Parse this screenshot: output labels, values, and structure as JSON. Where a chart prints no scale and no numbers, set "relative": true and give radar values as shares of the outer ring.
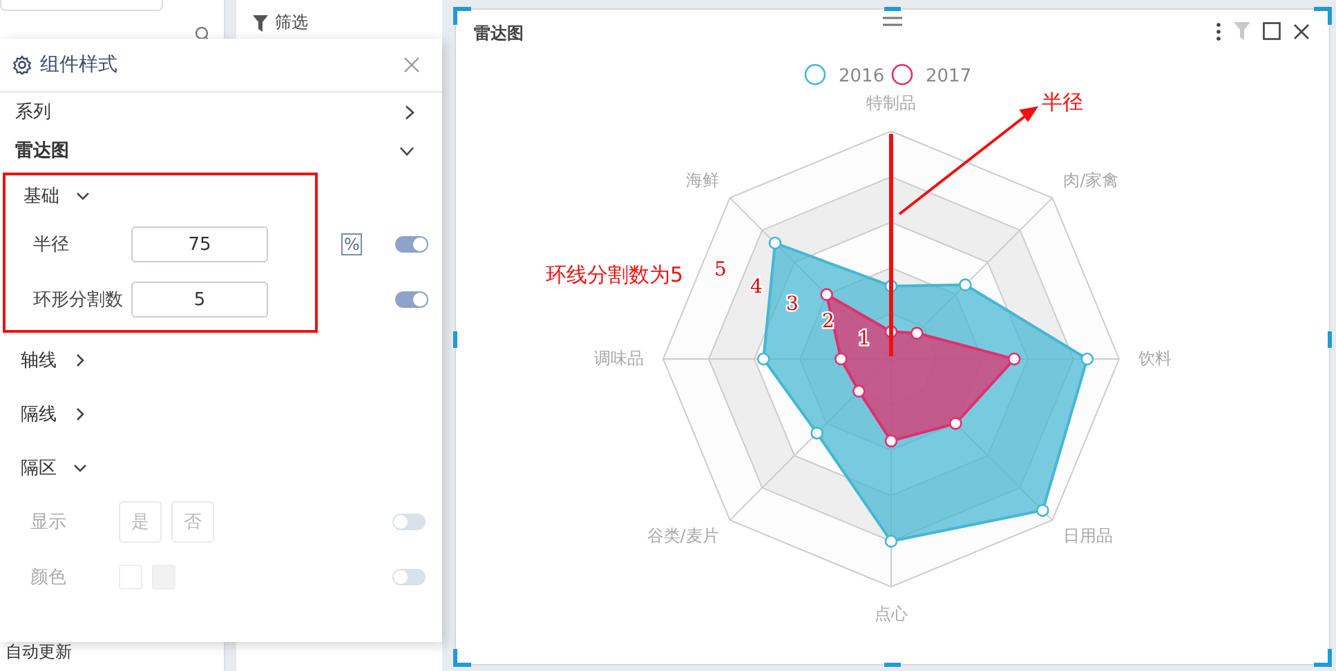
{
  "filter_pane": {
    "title": "筛选"
  },
  "sidebar": {
    "bottom_label": "自动更新"
  },
  "style_panel": {
    "title": "组件样式",
    "rows": [
      {
        "kind": "link",
        "label": "系列",
        "highlighted": false
      },
      {
        "kind": "header",
        "label": "雷达图",
        "expanded": true,
        "highlighted": false
      },
      {
        "kind": "sub",
        "label": "基础",
        "expanded": true,
        "highlighted": true
      },
      {
        "kind": "input",
        "label": "半径",
        "value": "75",
        "unit": "%",
        "on": true,
        "highlighted": true
      },
      {
        "kind": "input",
        "label": "环形分割数",
        "value": "5",
        "on": true,
        "highlighted": true
      },
      {
        "kind": "sub",
        "label": "轴线",
        "expanded": false,
        "highlighted": false
      },
      {
        "kind": "sub",
        "label": "隔线",
        "expanded": false,
        "highlighted": false
      },
      {
        "kind": "sub",
        "label": "隔区",
        "expanded": true,
        "highlighted": false
      },
      {
        "kind": "choice",
        "label": "显示",
        "options": [
          {
            "label": "是",
            "selected": false
          },
          {
            "label": "否",
            "selected": false
          }
        ],
        "on": false,
        "disabled": true,
        "highlighted": false
      },
      {
        "kind": "swatches",
        "label": "颜色",
        "swatches": [
          {
            "color": "#ffffff"
          },
          {
            "color": "#f2f2f2"
          }
        ],
        "on": false,
        "disabled": true,
        "highlighted": false
      }
    ]
  },
  "chart_card": {
    "title": "雷达图",
    "ring_labels": [
      "1",
      "2",
      "3",
      "4",
      "5"
    ],
    "notes": {
      "radius": "半径",
      "rings": "环线分割数为5"
    },
    "chart_data": {
      "type": "radar",
      "categories": [
        "特制品",
        "肉/家禽",
        "饮料",
        "日用品",
        "点心",
        "谷类/麦片",
        "调味品",
        "海鲜"
      ],
      "relative": true,
      "legend": "top",
      "series": [
        {
          "name": "2016",
          "color": "#45b7d3",
          "values": [
            0.32,
            0.46,
            0.86,
            0.94,
            0.8,
            0.46,
            0.56,
            0.72
          ]
        },
        {
          "name": "2017",
          "color": "#e0306e",
          "values": [
            0.12,
            0.16,
            0.54,
            0.4,
            0.36,
            0.2,
            0.22,
            0.4
          ]
        }
      ]
    }
  }
}
